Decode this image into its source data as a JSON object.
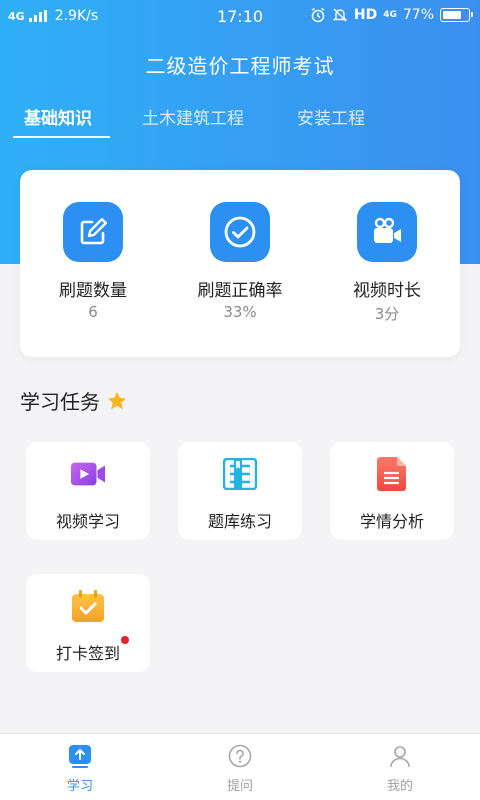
{
  "status_bar": {
    "network": "4G",
    "speed": "2.9K/s",
    "time": "17:10",
    "hd": "HD",
    "network_right": "4G",
    "battery": "77%",
    "battery_level": 0.77
  },
  "app_title": "二级造价工程师考试",
  "tabs": [
    {
      "label": "基础知识",
      "active": true
    },
    {
      "label": "土木建筑工程",
      "active": false
    },
    {
      "label": "安装工程",
      "active": false
    }
  ],
  "stats": [
    {
      "label": "刷题数量",
      "value": "6",
      "icon": "edit-icon"
    },
    {
      "label": "刷题正确率",
      "value": "33%",
      "icon": "check-circle-icon"
    },
    {
      "label": "视频时长",
      "value": "3分",
      "icon": "video-camera-icon"
    }
  ],
  "section": {
    "title": "学习任务",
    "icon": "star-icon"
  },
  "tasks": [
    {
      "label": "视频学习",
      "icon": "video-play-icon"
    },
    {
      "label": "题库练习",
      "icon": "question-bank-icon"
    },
    {
      "label": "学情分析",
      "icon": "report-icon"
    },
    {
      "label": "打卡签到",
      "icon": "calendar-check-icon",
      "badge": true
    }
  ],
  "bottom_nav": [
    {
      "label": "学习",
      "active": true,
      "icon": "study-icon"
    },
    {
      "label": "提问",
      "active": false,
      "icon": "question-icon"
    },
    {
      "label": "我的",
      "active": false,
      "icon": "profile-icon"
    }
  ],
  "colors": {
    "primary": "#2e8ff2",
    "header_gradient_start": "#2fb0f6",
    "header_gradient_end": "#3b8ff0",
    "badge": "#e3222a"
  }
}
